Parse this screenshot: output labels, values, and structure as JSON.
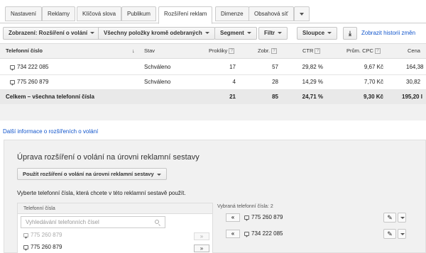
{
  "tabs": [
    {
      "label": "Nastavení",
      "active": false
    },
    {
      "label": "Reklamy",
      "active": false
    },
    {
      "label": "Klíčová slova",
      "active": false
    },
    {
      "label": "Publikum",
      "active": false
    },
    {
      "label": "Rozšíření reklam",
      "active": true
    },
    {
      "label": "Dimenze",
      "active": false
    },
    {
      "label": "Obsahová síť",
      "active": false
    }
  ],
  "toolbar": {
    "view_label": "Zobrazení: Rozšíření o volání",
    "filter_items_label": "Všechny položky kromě odebraných",
    "segment_label": "Segment",
    "filter_label": "Filtr",
    "columns_label": "Sloupce",
    "history_label": "Zobrazit historii změn"
  },
  "table": {
    "headers": {
      "phone": "Telefonní číslo",
      "status": "Stav",
      "clicks": "Prokliky",
      "impressions": "Zobr.",
      "ctr": "CTR",
      "avg_cpc": "Prům. CPC",
      "cost": "Cena"
    },
    "rows": [
      {
        "phone": "734 222 085",
        "status": "Schváleno",
        "clicks": "17",
        "impressions": "57",
        "ctr": "29,82 %",
        "avg_cpc": "9,67 Kč",
        "cost": "164,38"
      },
      {
        "phone": "775 260 879",
        "status": "Schváleno",
        "clicks": "4",
        "impressions": "28",
        "ctr": "14,29 %",
        "avg_cpc": "7,70 Kč",
        "cost": "30,82"
      }
    ],
    "total": {
      "label": "Celkem – všechna telefonní čísla",
      "clicks": "21",
      "impressions": "85",
      "ctr": "24,71 %",
      "avg_cpc": "9,30 Kč",
      "cost": "195,20 I"
    }
  },
  "more_info_link": "Další informace o rozšířeních o volání",
  "panel": {
    "title": "Úprava rozšíření o volání na úrovni reklamní sestavy",
    "use_button": "Použít rozšíření o volání na úrovni reklamní sestavy",
    "instruction": "Vyberte telefonní čísla, která chcete v této reklamní sestavě použít.",
    "left_header": "Telefonní čísla",
    "search_placeholder": "Vyhledávání telefonních čísel",
    "available": [
      {
        "number": "775 260 879",
        "disabled": true,
        "button": "»"
      },
      {
        "number": "775 260 879",
        "disabled": false,
        "button": "»"
      }
    ],
    "selected_header": "Vybraná telefonní čísla: 2",
    "selected": [
      {
        "number": "775 260 879",
        "button": "«"
      },
      {
        "number": "734 222 085",
        "button": "«"
      }
    ]
  },
  "icons": {
    "help": "?",
    "download": "download-icon",
    "pencil": "✎"
  }
}
